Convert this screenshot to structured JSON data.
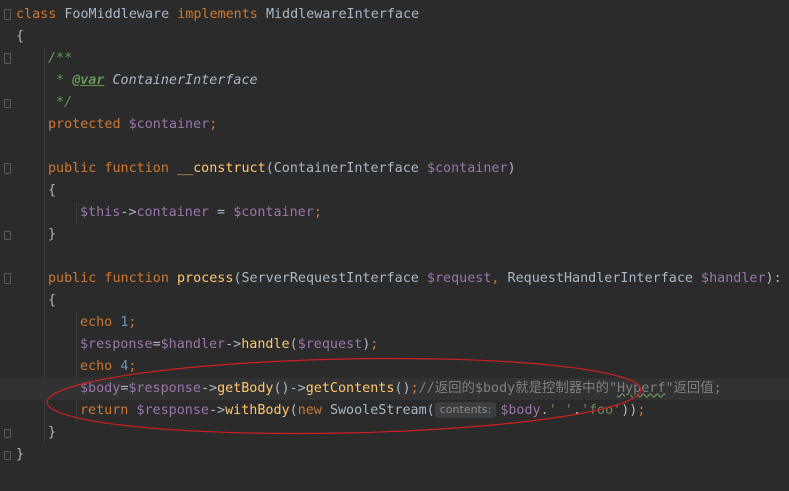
{
  "editor": {
    "lines": [
      {
        "indent": 0,
        "tokens": [
          [
            "kw",
            "class "
          ],
          [
            "plain",
            "FooMiddleware "
          ],
          [
            "kw",
            "implements "
          ],
          [
            "plain",
            "MiddlewareInterface"
          ]
        ]
      },
      {
        "indent": 0,
        "tokens": [
          [
            "plain",
            "{"
          ]
        ]
      },
      {
        "indent": 1,
        "tokens": [
          [
            "doc",
            "/**"
          ]
        ]
      },
      {
        "indent": 1,
        "tokens": [
          [
            "doc",
            " * "
          ],
          [
            "doctag",
            "@var"
          ],
          [
            "doc",
            " "
          ],
          [
            "doctype",
            "ContainerInterface"
          ]
        ]
      },
      {
        "indent": 1,
        "tokens": [
          [
            "doc",
            " */"
          ]
        ]
      },
      {
        "indent": 1,
        "tokens": [
          [
            "kw",
            "protected "
          ],
          [
            "var",
            "$container"
          ],
          [
            "kw",
            ";"
          ]
        ]
      },
      {
        "indent": 0,
        "tokens": []
      },
      {
        "indent": 1,
        "tokens": [
          [
            "kw",
            "public function "
          ],
          [
            "fn",
            "__construct"
          ],
          [
            "plain",
            "(ContainerInterface "
          ],
          [
            "var",
            "$container"
          ],
          [
            "plain",
            ")"
          ]
        ]
      },
      {
        "indent": 1,
        "tokens": [
          [
            "plain",
            "{"
          ]
        ]
      },
      {
        "indent": 2,
        "tokens": [
          [
            "var",
            "$this"
          ],
          [
            "plain",
            "->"
          ],
          [
            "var",
            "container"
          ],
          [
            "plain",
            " = "
          ],
          [
            "var",
            "$container"
          ],
          [
            "kw",
            ";"
          ]
        ]
      },
      {
        "indent": 1,
        "tokens": [
          [
            "plain",
            "}"
          ]
        ]
      },
      {
        "indent": 0,
        "tokens": []
      },
      {
        "indent": 1,
        "tokens": [
          [
            "kw",
            "public function "
          ],
          [
            "fn",
            "process"
          ],
          [
            "plain",
            "(ServerRequestInterface "
          ],
          [
            "var",
            "$request"
          ],
          [
            "kw",
            ", "
          ],
          [
            "plain",
            "RequestHandlerInterface "
          ],
          [
            "var",
            "$handler"
          ],
          [
            "plain",
            "): R"
          ]
        ]
      },
      {
        "indent": 1,
        "tokens": [
          [
            "plain",
            "{"
          ]
        ]
      },
      {
        "indent": 2,
        "tokens": [
          [
            "kw",
            "echo "
          ],
          [
            "num",
            "1"
          ],
          [
            "kw",
            ";"
          ]
        ]
      },
      {
        "indent": 2,
        "tokens": [
          [
            "var",
            "$response"
          ],
          [
            "plain",
            "="
          ],
          [
            "var",
            "$handler"
          ],
          [
            "plain",
            "->"
          ],
          [
            "fn",
            "handle"
          ],
          [
            "plain",
            "("
          ],
          [
            "var",
            "$request"
          ],
          [
            "plain",
            ")"
          ],
          [
            "kw",
            ";"
          ]
        ]
      },
      {
        "indent": 2,
        "tokens": [
          [
            "kw",
            "echo "
          ],
          [
            "num",
            "4"
          ],
          [
            "kw",
            ";"
          ]
        ]
      },
      {
        "indent": 2,
        "tokens": [
          [
            "var",
            "$body"
          ],
          [
            "plain",
            "="
          ],
          [
            "var",
            "$response"
          ],
          [
            "plain",
            "->"
          ],
          [
            "fn",
            "getBody"
          ],
          [
            "plain",
            "()->"
          ],
          [
            "fn",
            "getContents"
          ],
          [
            "plain",
            "()"
          ],
          [
            "kw",
            ";"
          ],
          [
            "cmt",
            "//返回的$body就是控制器中的\""
          ],
          [
            "cmt-typo",
            "Hyperf"
          ],
          [
            "cmt",
            "\"返回值;"
          ]
        ]
      },
      {
        "indent": 2,
        "tokens": [
          [
            "kw",
            "return "
          ],
          [
            "var",
            "$response"
          ],
          [
            "plain",
            "->"
          ],
          [
            "fn",
            "withBody"
          ],
          [
            "plain",
            "("
          ],
          [
            "kw",
            "new "
          ],
          [
            "plain",
            "SwooleStream("
          ],
          [
            "hint",
            "contents:"
          ],
          [
            "var",
            "$body"
          ],
          [
            "plain",
            "."
          ],
          [
            "str",
            "'_'"
          ],
          [
            "plain",
            "."
          ],
          [
            "str",
            "'foo'"
          ],
          [
            "plain",
            "))"
          ],
          [
            "kw",
            ";"
          ]
        ]
      },
      {
        "indent": 1,
        "tokens": [
          [
            "plain",
            "}"
          ]
        ]
      },
      {
        "indent": 0,
        "tokens": [
          [
            "plain",
            "}"
          ]
        ]
      }
    ]
  }
}
